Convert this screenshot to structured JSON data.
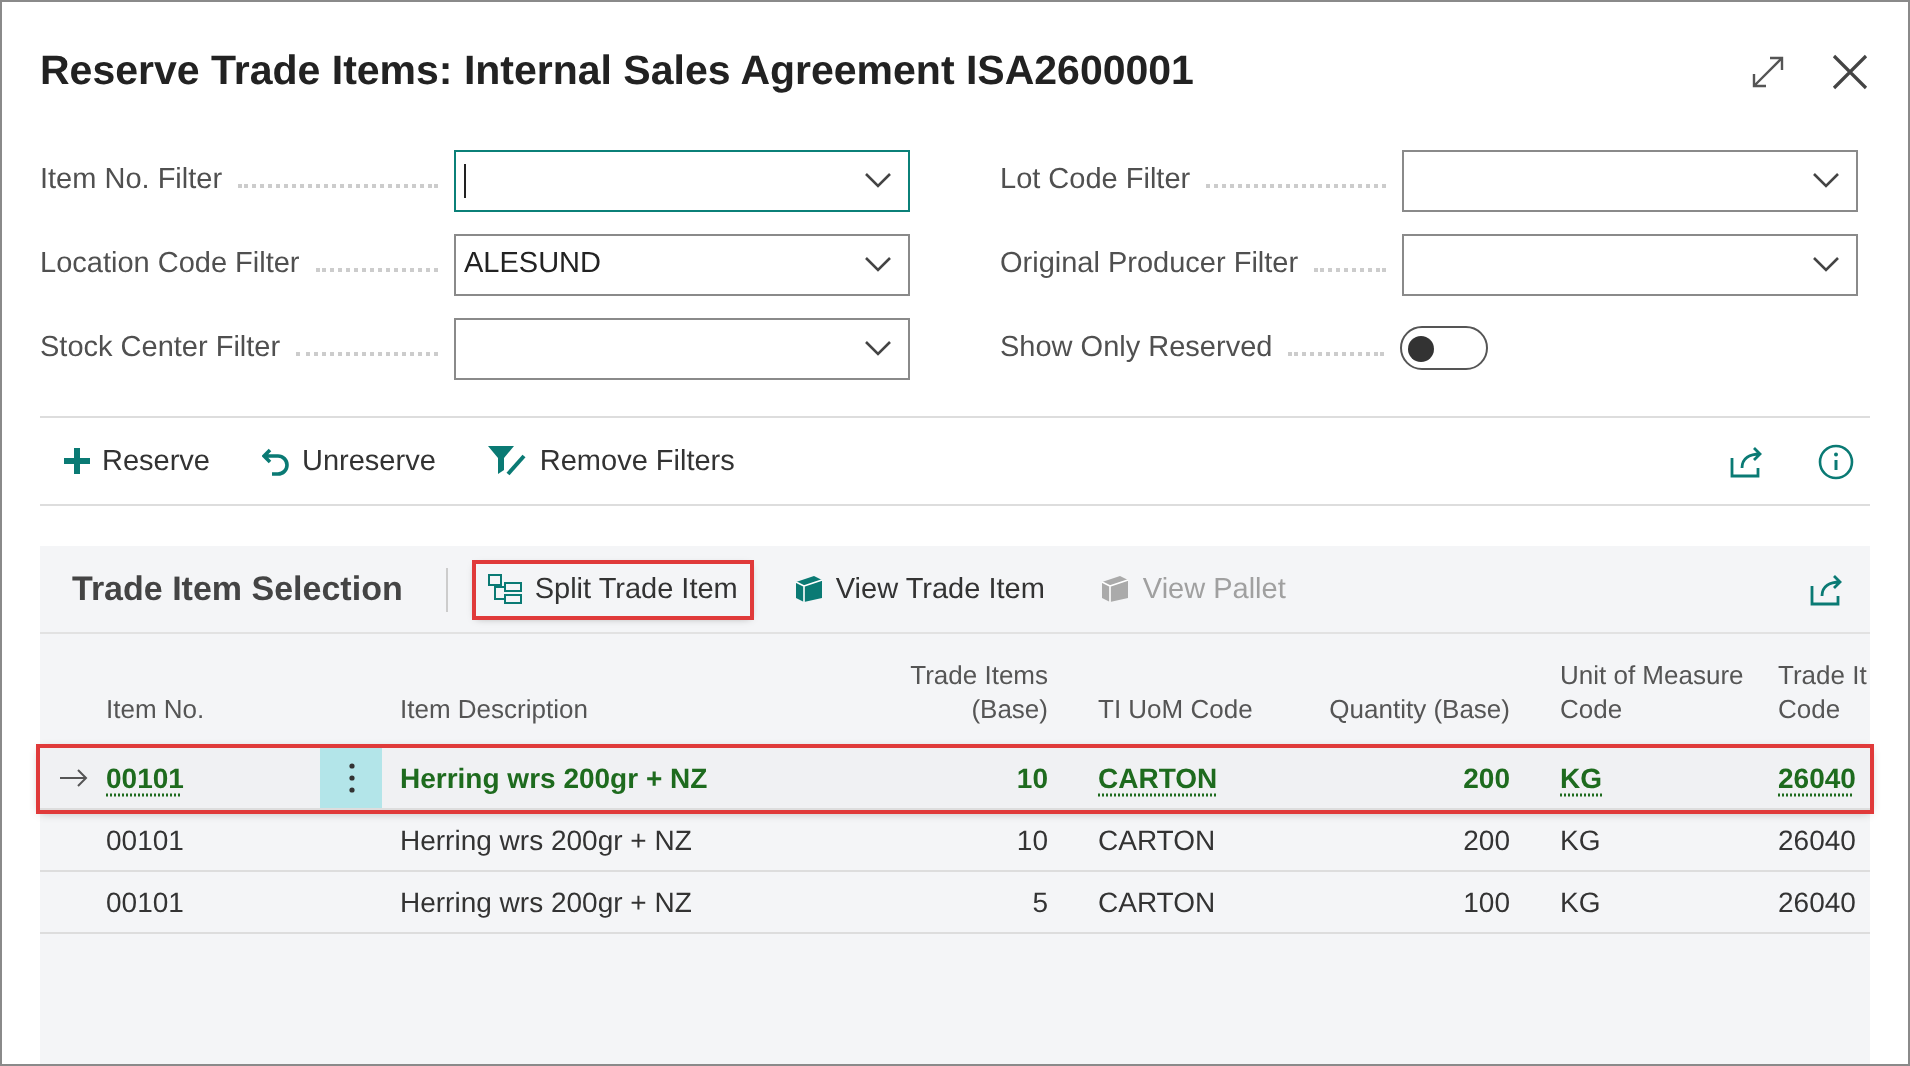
{
  "window": {
    "title": "Reserve Trade Items: Internal Sales Agreement ISA2600001"
  },
  "filters": [
    {
      "label": "Item No. Filter",
      "kind": "dropdown",
      "focused": true
    },
    {
      "label": "Lot Code Filter",
      "kind": "dropdown",
      "focused": false
    },
    {
      "label": "Location Code Filter",
      "kind": "dropdown",
      "value": "ALESUND",
      "focused": false
    },
    {
      "label": "Original Producer Filter",
      "kind": "dropdown",
      "focused": false
    },
    {
      "label": "Stock Center Filter",
      "kind": "dropdown",
      "focused": false
    },
    {
      "label": "Show Only Reserved",
      "kind": "toggle",
      "on": false
    }
  ],
  "actions": [
    {
      "label": "Reserve"
    },
    {
      "label": "Unreserve"
    },
    {
      "label": "Remove Filters"
    }
  ],
  "part": {
    "title": "Trade Item Selection",
    "actions": [
      {
        "label": "Split Trade Item",
        "disabled": false,
        "highlighted": true
      },
      {
        "label": "View Trade Item",
        "disabled": false,
        "highlighted": false
      },
      {
        "label": "View Pallet",
        "disabled": true,
        "highlighted": false
      }
    ],
    "columns": [
      "Item No.",
      "Item Description",
      "Trade Items (Base)",
      "TI UoM Code",
      "Quantity (Base)",
      "Unit of Measure Code",
      "Trade It Code"
    ],
    "rows": [
      {
        "selected": true,
        "highlighted": true,
        "cells": [
          "00101",
          "Herring wrs 200gr + NZ",
          "10",
          "CARTON",
          "200",
          "KG",
          "26040"
        ]
      },
      {
        "selected": false,
        "highlighted": false,
        "cells": [
          "00101",
          "Herring wrs 200gr + NZ",
          "10",
          "CARTON",
          "200",
          "KG",
          "26040"
        ]
      },
      {
        "selected": false,
        "highlighted": false,
        "cells": [
          "00101",
          "Herring wrs 200gr + NZ",
          "5",
          "CARTON",
          "100",
          "KG",
          "26040"
        ]
      }
    ]
  }
}
